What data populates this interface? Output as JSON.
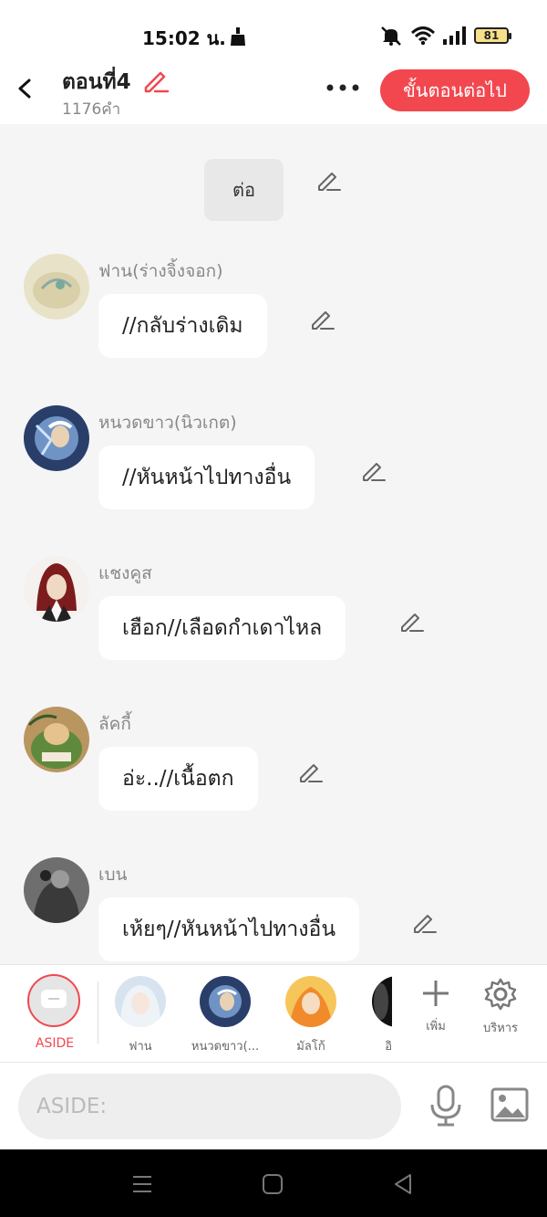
{
  "status_bar": {
    "time": "15:02 น.",
    "battery": "81"
  },
  "header": {
    "title": "ตอนที่4",
    "word_count": "1176คำ",
    "next_button": "ขั้นตอนต่อไป"
  },
  "chat": {
    "system_message": "ต่อ",
    "messages": [
      {
        "name": "ฟาน(ร่างจิ้งจอก)",
        "text": "//กลับร่างเดิม"
      },
      {
        "name": "หนวดขาว(นิวเกต)",
        "text": "//หันหน้าไปทางอื่น"
      },
      {
        "name": "แชงคูส",
        "text": "เฮือก//เลือดกำเดาไหล"
      },
      {
        "name": "ลัคกี้",
        "text": "อ่ะ..//เนื้อตก"
      },
      {
        "name": "เบน",
        "text": "เห้ยๆ//หันหน้าไปทางอื่น"
      }
    ]
  },
  "character_bar": {
    "aside_label": "ASIDE",
    "characters": [
      {
        "label": "ฟาน"
      },
      {
        "label": "หนวดขาว(..."
      },
      {
        "label": "มัลโก้"
      },
      {
        "label": "อิ"
      }
    ],
    "add_label": "เพิ่ม",
    "manage_label": "บริหาร"
  },
  "input": {
    "placeholder": "ASIDE:"
  },
  "colors": {
    "accent": "#f2474f",
    "background": "#f5f5f5"
  }
}
